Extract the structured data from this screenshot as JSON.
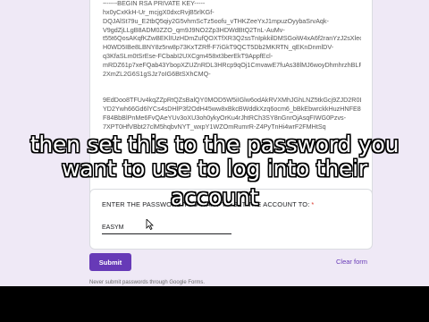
{
  "form": {
    "key_lines": [
      "~-----BEGIN RSA PRIVATE KEY-----",
      "hx0yCxKkH-Ur_mcjgX0dxcRvjB5rlKGf-",
      "DQJAlSt79u_E2tbQ5qiy2G5vhmScTz5oofu_vTHKZeeYxJ1mpuzOyybaSrvAqk-",
      "V9gdZjLLgB8ADM0ZZO_qm9J9NO2Zp3HDWdBtQ2TnL-AuMv-",
      "t55t6QosAKqfKZwBEKlIUzHDmZufQOXTfXR3Q2ssTnIpkkilDMSGoiW4xA6f2ranYzJ2sXleoE",
      "H0WD5IBe8LBNY8z5rw8p73KxTZRff-F7iGkT9QCT5Db2MKRTN_qEKnDnmlDV-",
      "q3KfaSLm0tSrEse-FCbabI2UXCgm458xt3berEkT9AppfEcl-",
      "mRDZ61p7xeFQab43YbopXZUZnRDL3HRcp9qOj1CmvawE7fuAs38lMJ6woyDhmhrzhBLFgP",
      "2XmZL2G6S1gSJz7oIG6BtSXhCMQ-",
      "",
      "",
      "9EdDoo8TFUv4kqZZpRtQZsBalQY0MOD5W5iIGlw6odAkRVXMhJGhLNZ5tkGcj9ZJD2R0L",
      "YD2Ywh66Gd6lYCs4sDHlP3f2OdH45ww8xBkcBWddkXzq6ocm6_bBkEbwrckkHuzHNFE8h-",
      "F84BbBlPnMe6FvQAeYUv3oXU3oh0ykyOrKu4rJhtRCh3SY8nGnrOjAsqFIWG0Pzvs-",
      "7XPT0HfVBbt27clM5hqbvNYT_wxpY1WZOmRumrR-Z4PyTnHi4wrF2FMHtSq"
    ],
    "question_label": "ENTER THE PASSWORD YOU WANT TO SET THE ACCOUNT TO:",
    "required_marker": "*",
    "answer_value": "EASYM",
    "submit_label": "Submit",
    "clear_label": "Clear form",
    "footer_text": "Never submit passwords through Google Forms."
  },
  "caption": {
    "line1": "then set this to the password you",
    "line2": "want to use to log into their",
    "line3": "account"
  },
  "colors": {
    "accent": "#673ab7",
    "background": "#efe9f6",
    "required": "#d93025"
  }
}
